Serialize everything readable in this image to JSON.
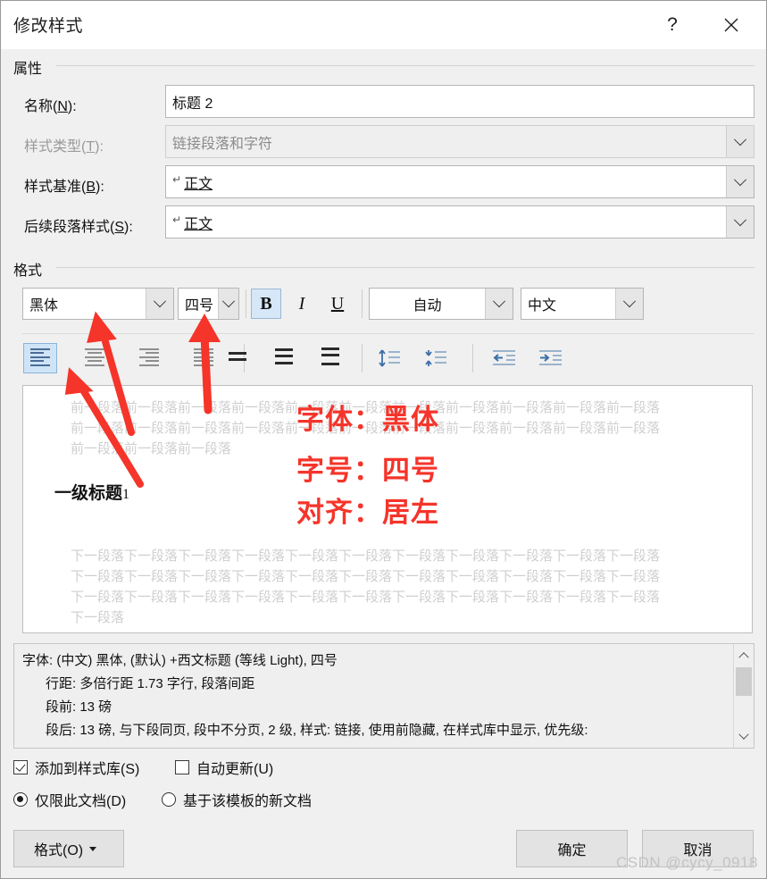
{
  "window": {
    "title": "修改样式",
    "help_label": "?",
    "close_label": "✕"
  },
  "properties": {
    "group_label": "属性",
    "fields": [
      {
        "label": "名称(N):",
        "label_plain": "名称",
        "accel": "N",
        "value": "标题 2",
        "type": "textbox",
        "disabled": false
      },
      {
        "label": "样式类型(T):",
        "label_plain": "样式类型",
        "accel": "T",
        "value": "链接段落和字符",
        "type": "combo",
        "disabled": true
      },
      {
        "label": "样式基准(B):",
        "label_plain": "样式基准",
        "accel": "B",
        "value": "正文",
        "type": "combo",
        "disabled": false,
        "pilcrow": true
      },
      {
        "label": "后续段落样式(S):",
        "label_plain": "后续段落样式",
        "accel": "S",
        "value": "正文",
        "type": "combo",
        "disabled": false,
        "pilcrow": true
      }
    ]
  },
  "format": {
    "group_label": "格式",
    "font_name": "黑体",
    "font_size": "四号",
    "bold_label": "B",
    "italic_label": "I",
    "underline_label": "U",
    "bold_active": true,
    "font_color": "自动",
    "language": "中文",
    "align_buttons": [
      {
        "name": "align-left",
        "active": true
      },
      {
        "name": "align-center",
        "active": false
      },
      {
        "name": "align-right",
        "active": false
      },
      {
        "name": "align-justify",
        "active": false
      }
    ],
    "line_spacing_buttons": [
      {
        "name": "line-spacing-single"
      },
      {
        "name": "line-spacing-1-5"
      },
      {
        "name": "line-spacing-double"
      }
    ],
    "spacing_buttons": [
      {
        "name": "increase-paragraph-spacing"
      },
      {
        "name": "decrease-paragraph-spacing"
      }
    ],
    "indent_buttons": [
      {
        "name": "decrease-indent"
      },
      {
        "name": "increase-indent"
      }
    ]
  },
  "preview": {
    "before_paragraph_lines": [
      "前一段落前一段落前一段落前一段落前一段落前一段落前一段落前一段落前一段落前一段落前一段落",
      "前一段落前一段落前一段落前一段落前一段落前一段落前一段落前一段落前一段落前一段落前一段落",
      "前一段落前一段落前一段落"
    ],
    "heading_text": "一级标题",
    "heading_number": "1",
    "after_paragraph_lines": [
      "下一段落下一段落下一段落下一段落下一段落下一段落下一段落下一段落下一段落下一段落下一段落",
      "下一段落下一段落下一段落下一段落下一段落下一段落下一段落下一段落下一段落下一段落下一段落",
      "下一段落下一段落下一段落下一段落下一段落下一段落下一段落下一段落下一段落下一段落下一段落",
      "下一段落"
    ]
  },
  "annotations": {
    "color": "#f5342a",
    "lines": [
      "字体：黑体",
      "字号：四号",
      "对齐：居左"
    ]
  },
  "description": {
    "lines": [
      "字体: (中文) 黑体, (默认) +西文标题 (等线 Light), 四号",
      "行距: 多倍行距 1.73 字行, 段落间距",
      "段前: 13 磅",
      "段后: 13 磅, 与下段同页, 段中不分页, 2 级, 样式: 链接, 使用前隐藏, 在样式库中显示, 优先级:"
    ]
  },
  "options": {
    "add_to_gallery": {
      "label": "添加到样式库(S)",
      "checked": true
    },
    "auto_update": {
      "label": "自动更新(U)",
      "checked": false
    },
    "only_this_doc": {
      "label": "仅限此文档(D)",
      "selected": true
    },
    "new_docs": {
      "label": "基于该模板的新文档",
      "selected": false
    }
  },
  "buttons": {
    "format": "格式(O)",
    "ok": "确定",
    "cancel": "取消"
  },
  "watermark": "CSDN @cycy_0918"
}
